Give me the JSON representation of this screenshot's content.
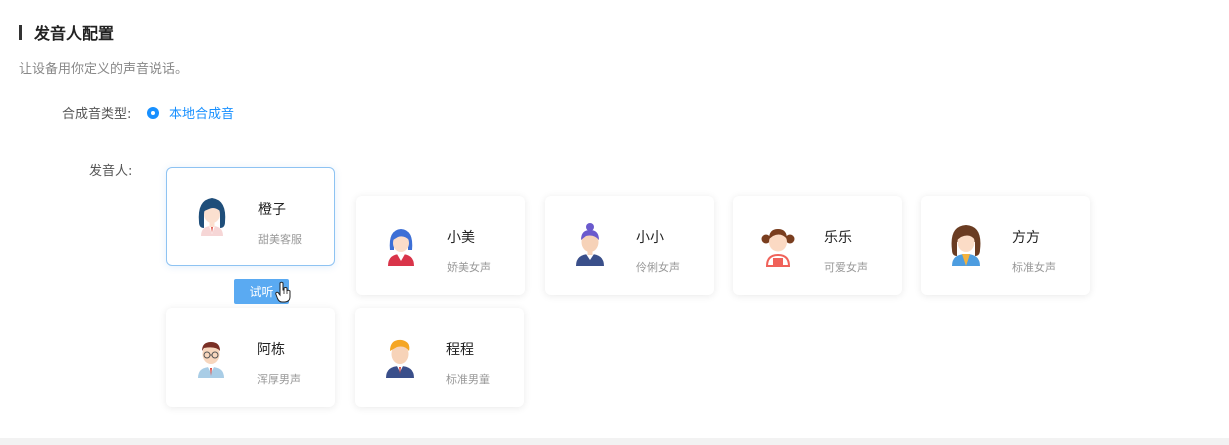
{
  "section": {
    "title": "发音人配置",
    "description": "让设备用你定义的声音说话。"
  },
  "synthesis": {
    "label": "合成音类型:",
    "selected_option": "本地合成音"
  },
  "speakers": {
    "label": "发音人:",
    "listen_label": "试听",
    "items": [
      {
        "name": "橙子",
        "desc": "甜美客服",
        "avatar": "female-long-hair-avatar-icon",
        "selected": true
      },
      {
        "name": "小美",
        "desc": "娇美女声",
        "avatar": "female-blue-hair-avatar-icon",
        "selected": false
      },
      {
        "name": "小小",
        "desc": "伶俐女声",
        "avatar": "girl-bun-avatar-icon",
        "selected": false
      },
      {
        "name": "乐乐",
        "desc": "可爱女声",
        "avatar": "girl-pigtails-avatar-icon",
        "selected": false
      },
      {
        "name": "方方",
        "desc": "标准女声",
        "avatar": "woman-brown-hair-avatar-icon",
        "selected": false
      },
      {
        "name": "阿栋",
        "desc": "浑厚男声",
        "avatar": "man-glasses-avatar-icon",
        "selected": false
      },
      {
        "name": "程程",
        "desc": "标准男童",
        "avatar": "boy-blonde-avatar-icon",
        "selected": false
      }
    ]
  },
  "colors": {
    "accent": "#1890ff",
    "button": "#5aaaf2",
    "selected_border": "#8ec3f2"
  }
}
